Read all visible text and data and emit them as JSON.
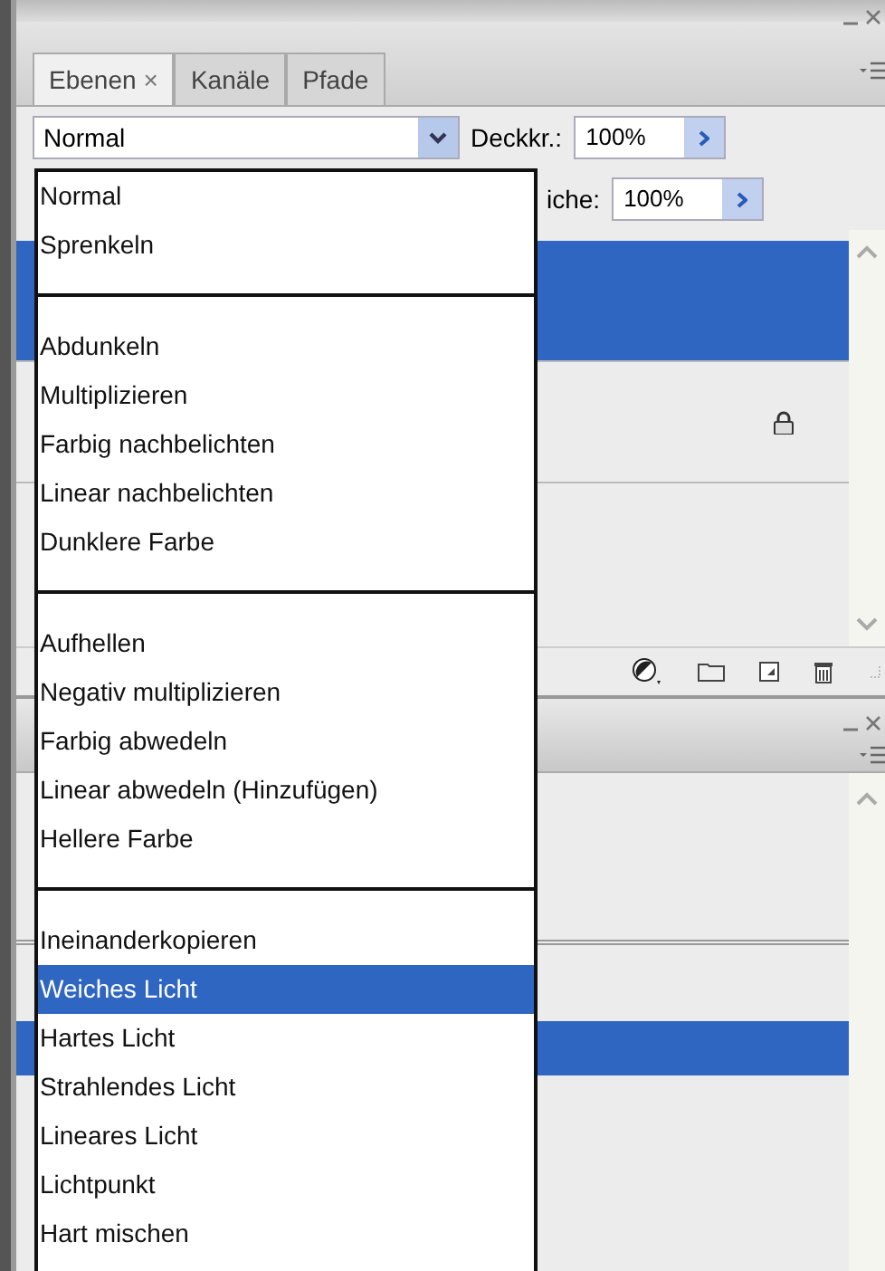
{
  "layers_panel": {
    "tabs": [
      {
        "label": "Ebenen",
        "close": "×",
        "selected": true
      },
      {
        "label": "Kanäle",
        "selected": false
      },
      {
        "label": "Pfade",
        "selected": false
      }
    ],
    "blend_mode": {
      "value": "Normal"
    },
    "opacity": {
      "label": "Deckkr.:",
      "value": "100%"
    },
    "fill": {
      "label": "iche:",
      "value": "100%"
    },
    "layers": [
      {
        "selected": true,
        "locked": false
      },
      {
        "selected": false,
        "locked": true
      }
    ]
  },
  "second_panel": {
    "rows": [
      {
        "selected": false
      },
      {
        "selected": true
      }
    ]
  },
  "blend_menu": {
    "groups": [
      {
        "items": [
          {
            "label": "Normal",
            "selected": false
          },
          {
            "label": "Sprenkeln",
            "selected": false
          }
        ]
      },
      {
        "items": [
          {
            "label": "Abdunkeln",
            "selected": false
          },
          {
            "label": "Multiplizieren",
            "selected": false
          },
          {
            "label": "Farbig nachbelichten",
            "selected": false
          },
          {
            "label": "Linear nachbelichten",
            "selected": false
          },
          {
            "label": "Dunklere Farbe",
            "selected": false
          }
        ]
      },
      {
        "items": [
          {
            "label": "Aufhellen",
            "selected": false
          },
          {
            "label": "Negativ multiplizieren",
            "selected": false
          },
          {
            "label": "Farbig abwedeln",
            "selected": false
          },
          {
            "label": "Linear abwedeln (Hinzufügen)",
            "selected": false
          },
          {
            "label": "Hellere Farbe",
            "selected": false
          }
        ]
      },
      {
        "items": [
          {
            "label": "Ineinanderkopieren",
            "selected": false
          },
          {
            "label": "Weiches Licht",
            "selected": true
          },
          {
            "label": "Hartes Licht",
            "selected": false
          },
          {
            "label": "Strahlendes Licht",
            "selected": false
          },
          {
            "label": "Lineares Licht",
            "selected": false
          },
          {
            "label": "Lichtpunkt",
            "selected": false
          },
          {
            "label": "Hart mischen",
            "selected": false
          }
        ]
      }
    ]
  }
}
